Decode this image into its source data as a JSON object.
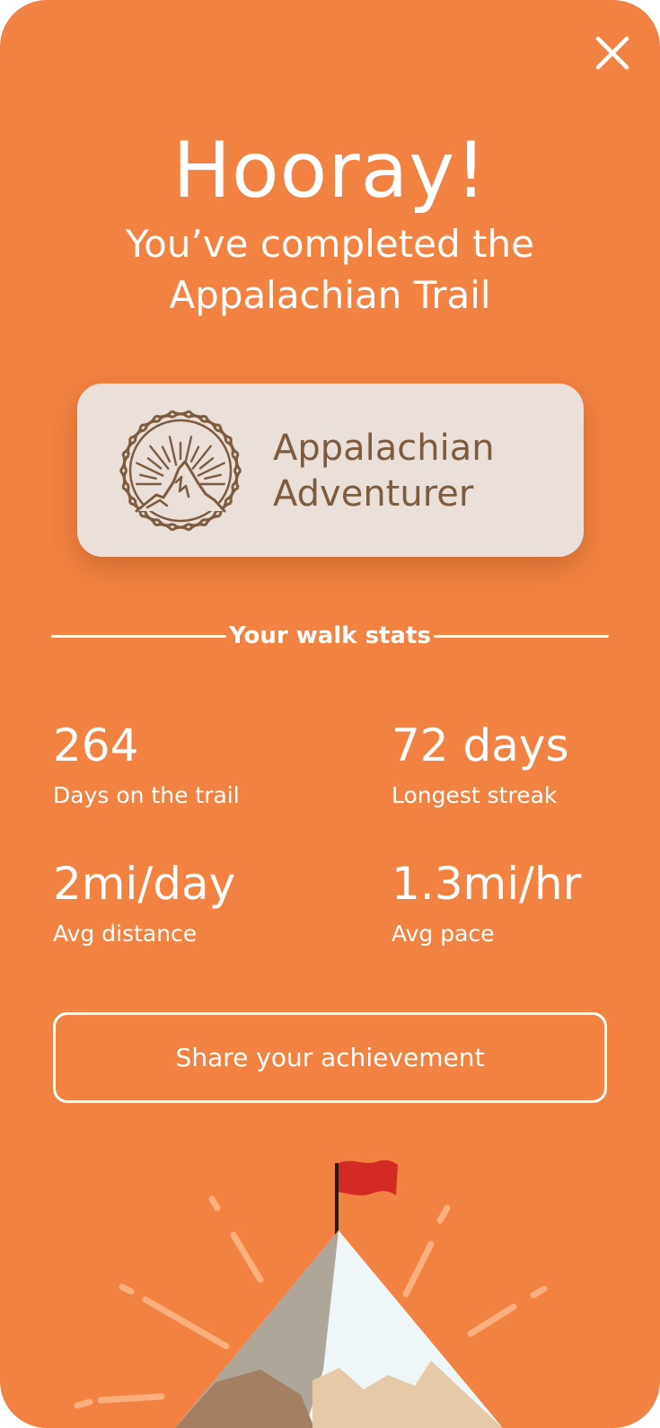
{
  "icons": {
    "close": "close-icon",
    "badge": "mountain-sunburst-emblem-icon",
    "illustration": "summit-flag-icon"
  },
  "colors": {
    "background": "#F28241",
    "card": "#EAE0D9",
    "badge_brown": "#7E5B3E",
    "flag_red": "#D42A25"
  },
  "celebration": {
    "headline": "Hooray!",
    "subhead_line1": "You’ve completed the",
    "subhead_line2": "Appalachian Trail"
  },
  "badge": {
    "title_line1": "Appalachian",
    "title_line2": "Adventurer"
  },
  "stats": {
    "section_title": "Your walk stats",
    "items": [
      {
        "value": "264",
        "label": "Days on the trail"
      },
      {
        "value": "72 days",
        "label": "Longest streak"
      },
      {
        "value": "2mi/day",
        "label": "Avg distance"
      },
      {
        "value": "1.3mi/hr",
        "label": "Avg pace"
      }
    ]
  },
  "actions": {
    "share_label": "Share your achievement"
  }
}
